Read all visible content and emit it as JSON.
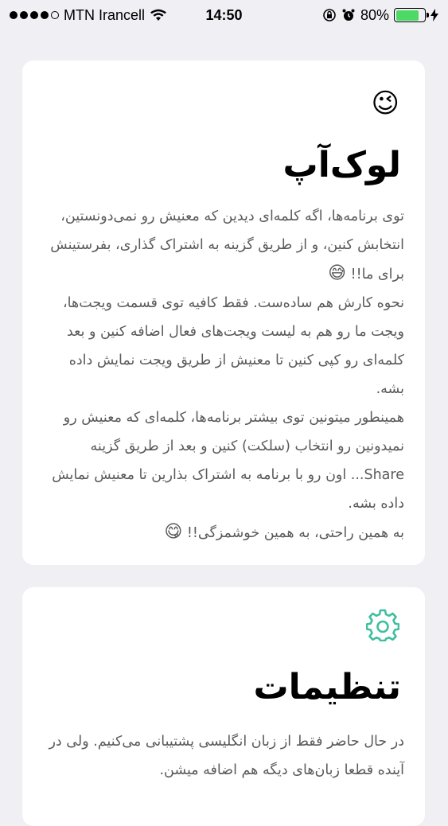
{
  "status_bar": {
    "carrier": "MTN Irancell",
    "time": "14:50",
    "battery_percent": "80%",
    "battery_level": 0.8,
    "signal_bars_filled": 4,
    "signal_bars_total": 5,
    "battery_color": "#4cd964"
  },
  "lookup_card": {
    "icon": "winking-face-emoji",
    "icon_glyph": "😉",
    "title": "لوک‌آپ",
    "lines": [
      "توی برنامه‌ها، اگه کلمه‌ای دیدین که معنیش رو نمی‌دونستین، انتخابش کنین، و از طریق گزینه به اشتراک گذاری، بفرستینش برای ما!!",
      "نحوه کارش هم ساده‌ست. فقط کافیه توی قسمت ویجت‌ها، ویجت ما رو هم به لیست ویجت‌های فعال اضافه کنین و بعد کلمه‌ای رو کپی کنین تا معنیش از طریق ویجت نمایش داده بشه.",
      "همینطور میتونین توی بیشتر برنامه‌ها، کلمه‌ای که معنیش رو نمیدونین رو انتخاب (سلکت) کنین و بعد از طریق گزینه Share... اون رو با برنامه به اشتراک بذارین تا معنیش نمایش داده بشه.",
      "به همین راحتی، به همین خوشمزگی!!"
    ],
    "emoji_1": "😅",
    "emoji_2": "😋"
  },
  "settings_card": {
    "icon": "gear-icon",
    "accent_color": "#3fbf9f",
    "title": "تنظیمات",
    "lines": [
      "در حال حاضر فقط از زبان انگلیسی پشتیبانی می‌کنیم. ولی در آینده قطعا زبان‌های دیگه هم اضافه میشن."
    ]
  }
}
